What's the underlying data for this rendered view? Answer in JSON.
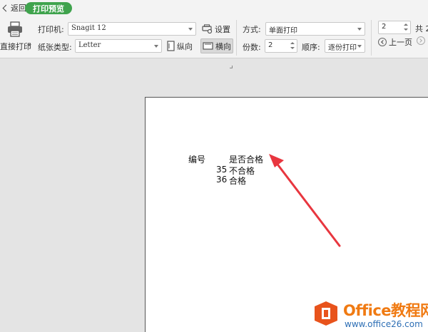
{
  "topbar": {
    "back_label": "返回",
    "preview_label": "打印预览"
  },
  "toolbar": {
    "print_label": "直接打印",
    "printer_label": "打印机:",
    "printer_value": "Snagit 12",
    "settings_label": "设置",
    "paper_type_label": "纸张类型:",
    "paper_type_value": "Letter",
    "portrait_label": "纵向",
    "landscape_label": "横向",
    "mode_label": "方式:",
    "mode_value": "单面打印",
    "copies_label": "份数:",
    "copies_value": "2",
    "order_label": "顺序:",
    "order_value": "逐份打印",
    "page_value": "2",
    "total_label": "共 2",
    "prev_label": "上一页"
  },
  "document": {
    "header_id": "编号",
    "header_pass": "是否合格",
    "rows": [
      {
        "id": "35",
        "pass": "不合格"
      },
      {
        "id": "36",
        "pass": "合格"
      }
    ]
  },
  "annotation": {
    "arrow_color": "#e8363f"
  },
  "watermark": {
    "name": "Office教程网",
    "url": "www.office26.com",
    "logo_color": "#e8531c",
    "name_color": "#f07a12",
    "url_color": "#2e6fb5"
  }
}
